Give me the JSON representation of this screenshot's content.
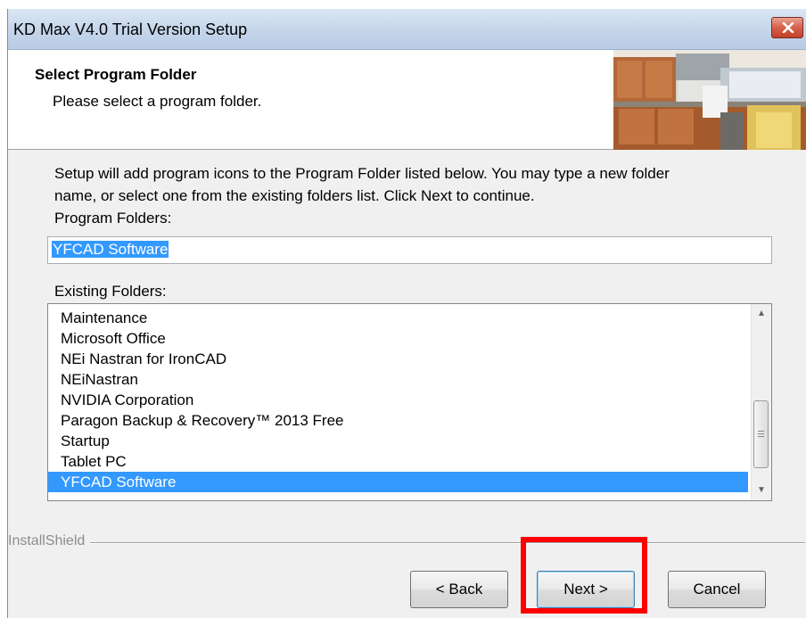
{
  "window": {
    "title": "KD Max V4.0 Trial Version Setup"
  },
  "header": {
    "title": "Select Program Folder",
    "subtitle": "Please select a program folder."
  },
  "instructions": {
    "line1": "Setup will add program icons to the Program Folder listed below.  You may type a new folder",
    "line2": "name, or select one from the existing folders list.  Click Next to continue."
  },
  "program_folders": {
    "label": "Program Folders:",
    "value": "YFCAD Software"
  },
  "existing_folders": {
    "label": "Existing Folders:",
    "items": [
      "Maintenance",
      "Microsoft Office",
      "NEi Nastran for IronCAD",
      "NEiNastran",
      "NVIDIA Corporation",
      "Paragon Backup & Recovery™ 2013 Free",
      "Startup",
      "Tablet PC",
      "YFCAD Software"
    ],
    "selected": "YFCAD Software"
  },
  "footer": {
    "brand": "InstallShield"
  },
  "buttons": {
    "back": "< Back",
    "next": "Next >",
    "cancel": "Cancel"
  },
  "colors": {
    "selection": "#3399ff",
    "highlight": "#ff0000"
  }
}
